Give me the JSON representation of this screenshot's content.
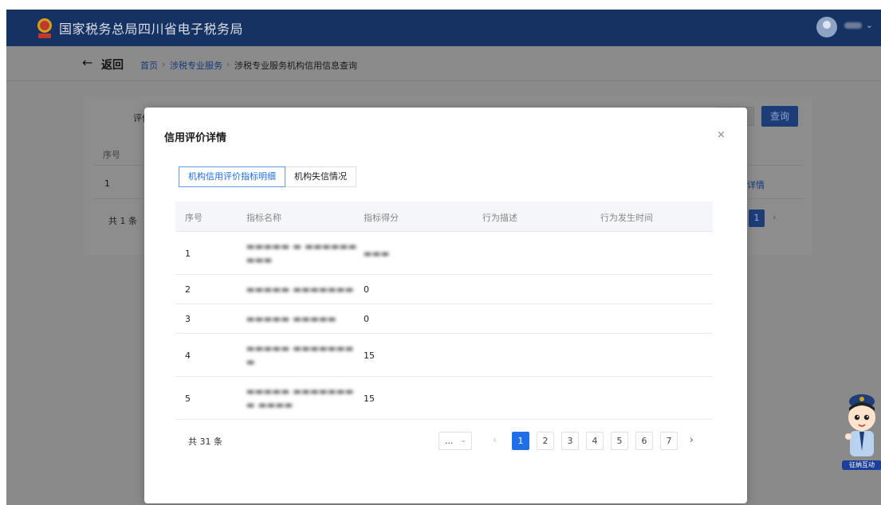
{
  "header": {
    "title": "国家税务总局四川省电子税务局"
  },
  "subheader": {
    "back_label": "返回",
    "breadcrumb": [
      "首页",
      "涉税专业服务",
      "涉税专业服务机构信用信息查询"
    ]
  },
  "background": {
    "filter_label": "评价",
    "query_button": "查询",
    "column_seq": "序号",
    "row_seq": "1",
    "detail_link": "详情",
    "total": "共 1 条",
    "page": "1"
  },
  "modal": {
    "title": "信用评价详情",
    "close": "×",
    "tabs": [
      "机构信用评价指标明细",
      "机构失信情况"
    ],
    "active_tab": 0,
    "columns": [
      "序号",
      "指标名称",
      "指标得分",
      "行为描述",
      "行为发生时间"
    ],
    "rows": [
      {
        "seq": "1",
        "name": "",
        "score": "",
        "desc": "",
        "time": ""
      },
      {
        "seq": "2",
        "name": "",
        "score": "0",
        "desc": "",
        "time": ""
      },
      {
        "seq": "3",
        "name": "",
        "score": "0",
        "desc": "",
        "time": ""
      },
      {
        "seq": "4",
        "name": "",
        "score": "15",
        "desc": "",
        "time": ""
      },
      {
        "seq": "5",
        "name": "",
        "score": "15",
        "desc": "",
        "time": ""
      }
    ],
    "pagination": {
      "total": "共 31 条",
      "size_select": "...",
      "pages": [
        "1",
        "2",
        "3",
        "4",
        "5",
        "6",
        "7"
      ],
      "current": "1"
    }
  },
  "mascot": {
    "label": "征纳互动"
  },
  "colors": {
    "header_bg": "#163263",
    "accent": "#1e6fe8",
    "overlay": "#8a8a8a"
  }
}
